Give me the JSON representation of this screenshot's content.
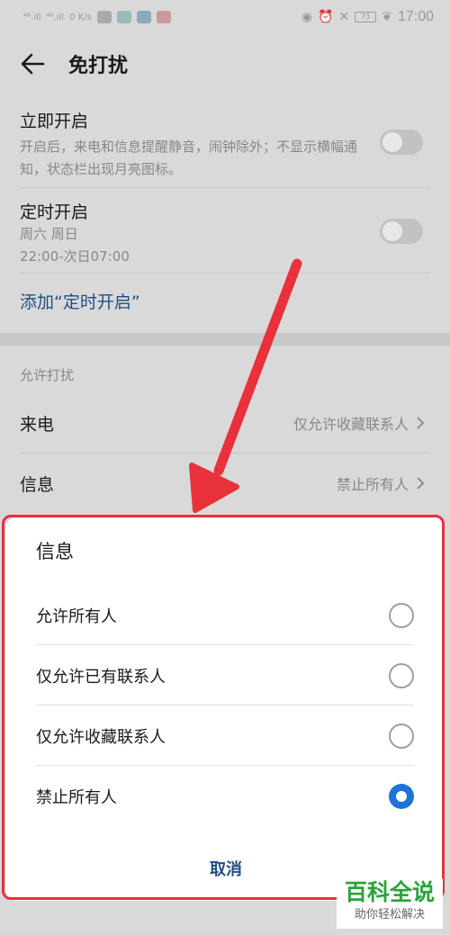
{
  "status_bar": {
    "signal_1": "⁴⁶.ıll",
    "signal_2": "⁴⁶.ıll",
    "speed": "0 K/s",
    "battery": "73",
    "time": "17:00"
  },
  "header": {
    "title": "免打扰"
  },
  "immediate": {
    "title": "立即开启",
    "desc": "开启后，来电和信息提醒静音，闹钟除外；不显示横幅通知，状态栏出现月亮图标。",
    "enabled": false
  },
  "scheduled": {
    "title": "定时开启",
    "days": "周六 周日",
    "time_range": "22:00-次日07:00",
    "enabled": false
  },
  "add_schedule": "添加“定时开启”",
  "allow_section": {
    "header": "允许打扰",
    "calls_label": "来电",
    "calls_value": "仅允许收藏联系人",
    "messages_label": "信息",
    "messages_value": "禁止所有人"
  },
  "dialog": {
    "title": "信息",
    "options": [
      {
        "label": "允许所有人",
        "selected": false
      },
      {
        "label": "仅允许已有联系人",
        "selected": false
      },
      {
        "label": "仅允许收藏联系人",
        "selected": false
      },
      {
        "label": "禁止所有人",
        "selected": true
      }
    ],
    "cancel": "取消"
  },
  "watermark": {
    "main": "百科全说",
    "sub": "助你轻松解决"
  },
  "colors": {
    "accent": "#1e73d6",
    "link": "#1d4f86",
    "annotation": "#e8313a",
    "watermark": "#2aa33a"
  }
}
